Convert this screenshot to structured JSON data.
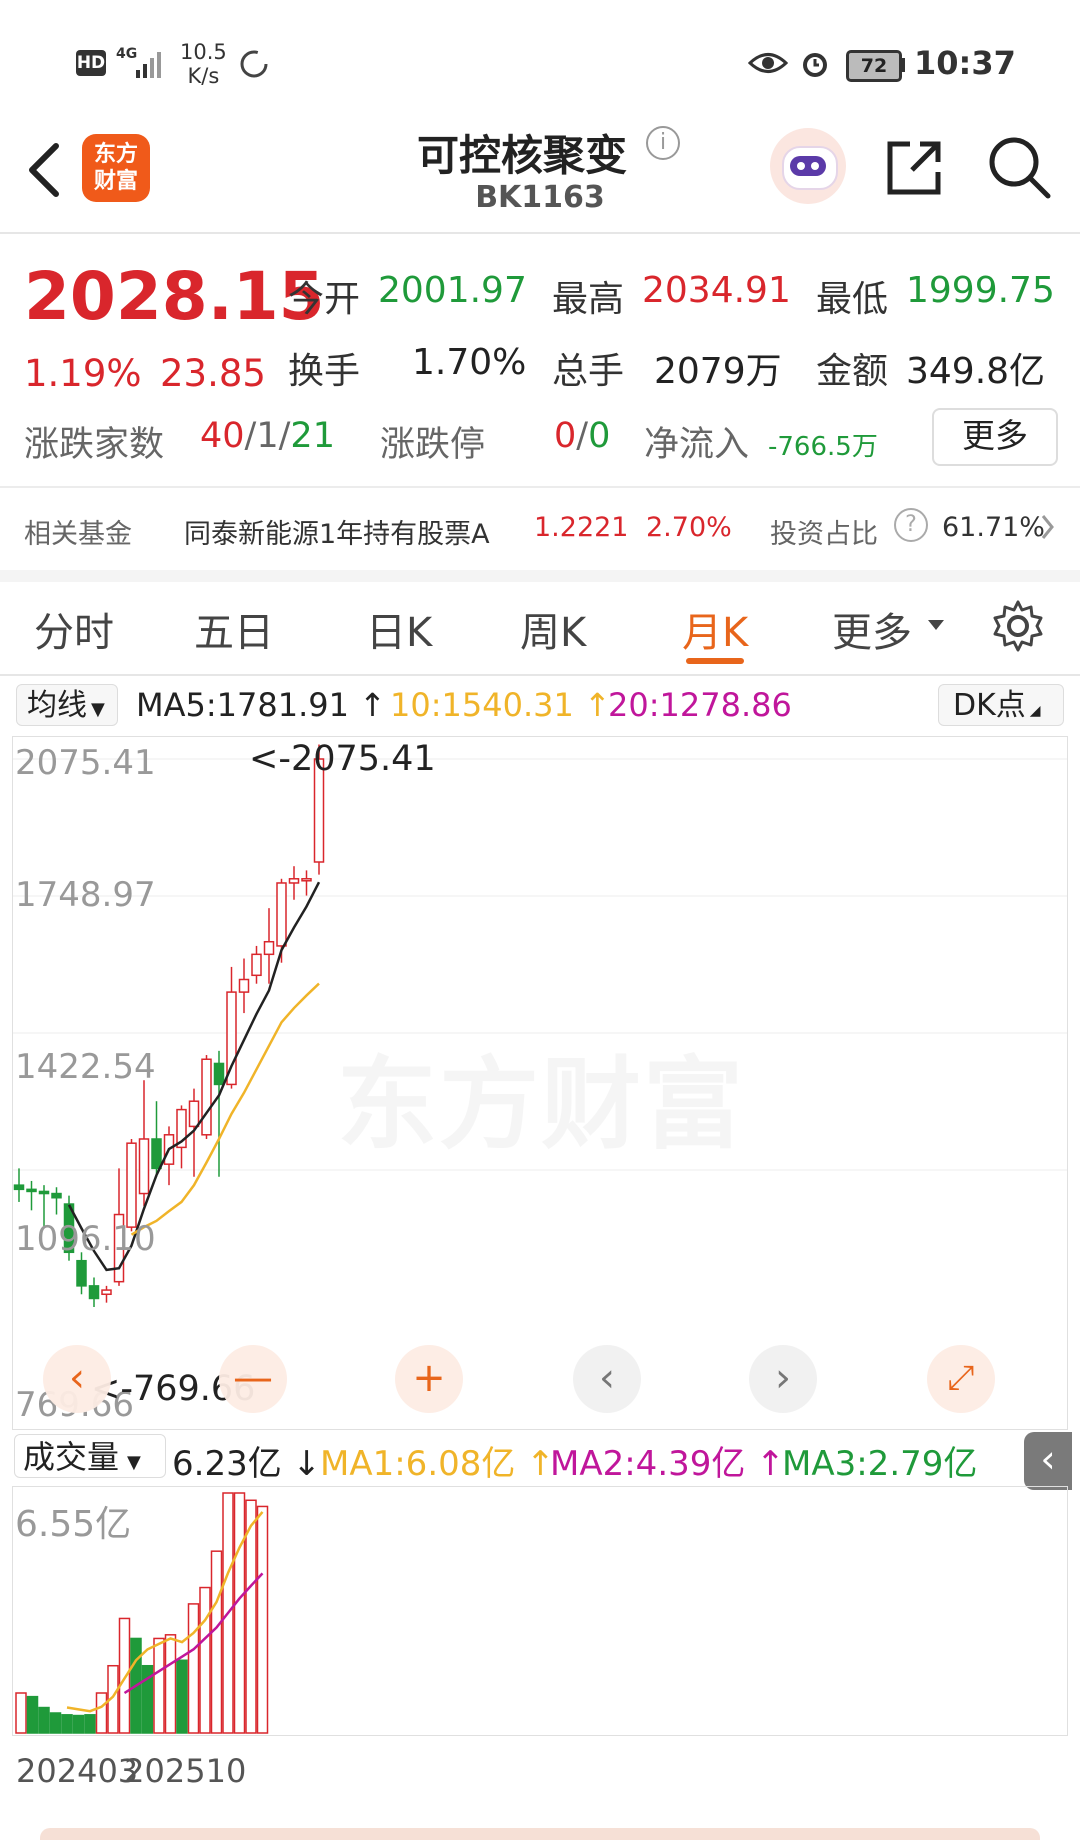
{
  "status_bar": {
    "hd": "HD",
    "signal": "4G",
    "speed_value": "10.5",
    "speed_unit": "K/s",
    "battery": "72",
    "time": "10:37"
  },
  "header": {
    "logo_line1": "东方",
    "logo_line2": "财富",
    "title": "可控核聚变",
    "code": "BK1163"
  },
  "quote": {
    "price": "2028.15",
    "change_pct": "1.19%",
    "change_abs": "23.85",
    "open_label": "今开",
    "open_value": "2001.97",
    "high_label": "最高",
    "high_value": "2034.91",
    "low_label": "最低",
    "low_value": "1999.75",
    "turnover_label": "换手",
    "turnover_value": "1.70%",
    "volume_label": "总手",
    "volume_value": "2079万",
    "amount_label": "金额",
    "amount_value": "349.8亿",
    "breadth_label": "涨跌家数",
    "breadth_up": "40",
    "breadth_flat": "1",
    "breadth_down": "21",
    "limit_label": "涨跌停",
    "limit_up": "0",
    "limit_down": "0",
    "inflow_label": "净流入",
    "inflow_value": "-766.5万",
    "more_button": "更多"
  },
  "fund": {
    "label": "相关基金",
    "name": "同泰新能源1年持有股票A",
    "nav": "1.2221",
    "change": "2.70%",
    "ratio_label": "投资占比",
    "ratio_value": "61.71%"
  },
  "tabs": [
    {
      "label": "分时"
    },
    {
      "label": "五日"
    },
    {
      "label": "日K"
    },
    {
      "label": "周K"
    },
    {
      "label": "月K"
    },
    {
      "label": "更多"
    }
  ],
  "ma_bar": {
    "selector": "均线",
    "ma5": "MA5:1781.91",
    "ma10": "10:1540.31",
    "ma20": "20:1278.86",
    "dk": "DK点"
  },
  "colors": {
    "up": "#d9262c",
    "down": "#1f9a3a",
    "ma5": "#222222",
    "ma10": "#f0b429",
    "ma20": "#c0169b",
    "accent": "#e8651b"
  },
  "volume_bar": {
    "selector": "成交量",
    "current": "6.23亿",
    "ma1": "MA1:6.08亿",
    "ma2": "MA2:4.39亿",
    "ma3": "MA3:2.79亿"
  },
  "chart_data": [
    {
      "type": "candlestick",
      "title": "",
      "y_ticks": [
        "2075.41",
        "1748.97",
        "1422.54",
        "1096.10",
        "769.66"
      ],
      "ylim": [
        769.66,
        2075.41
      ],
      "max_label": "<-2075.41",
      "min_label": "<-769.66",
      "watermark": "东方财富",
      "candles": [
        {
          "o": 1060,
          "h": 1100,
          "l": 1020,
          "c": 1050
        },
        {
          "o": 1050,
          "h": 1070,
          "l": 1000,
          "c": 1045
        },
        {
          "o": 1045,
          "h": 1060,
          "l": 960,
          "c": 1040
        },
        {
          "o": 1040,
          "h": 1055,
          "l": 990,
          "c": 1030
        },
        {
          "o": 1015,
          "h": 1035,
          "l": 880,
          "c": 900
        },
        {
          "o": 880,
          "h": 900,
          "l": 800,
          "c": 820
        },
        {
          "o": 820,
          "h": 840,
          "l": 769.66,
          "c": 790
        },
        {
          "o": 800,
          "h": 820,
          "l": 780,
          "c": 810
        },
        {
          "o": 830,
          "h": 1100,
          "l": 820,
          "c": 990
        },
        {
          "o": 960,
          "h": 1170,
          "l": 950,
          "c": 1160
        },
        {
          "o": 1040,
          "h": 1310,
          "l": 1010,
          "c": 1170
        },
        {
          "o": 1170,
          "h": 1260,
          "l": 1080,
          "c": 1100
        },
        {
          "o": 1110,
          "h": 1200,
          "l": 1060,
          "c": 1180
        },
        {
          "o": 1150,
          "h": 1250,
          "l": 1100,
          "c": 1240
        },
        {
          "o": 1200,
          "h": 1290,
          "l": 1080,
          "c": 1260
        },
        {
          "o": 1180,
          "h": 1370,
          "l": 1170,
          "c": 1360
        },
        {
          "o": 1350,
          "h": 1380,
          "l": 1080,
          "c": 1300
        },
        {
          "o": 1300,
          "h": 1580,
          "l": 1290,
          "c": 1520
        },
        {
          "o": 1520,
          "h": 1600,
          "l": 1470,
          "c": 1550
        },
        {
          "o": 1560,
          "h": 1630,
          "l": 1540,
          "c": 1610
        },
        {
          "o": 1610,
          "h": 1720,
          "l": 1540,
          "c": 1640
        },
        {
          "o": 1630,
          "h": 1790,
          "l": 1590,
          "c": 1780
        },
        {
          "o": 1780,
          "h": 1820,
          "l": 1740,
          "c": 1790
        },
        {
          "o": 1790,
          "h": 1810,
          "l": 1750,
          "c": 1790
        },
        {
          "o": 1830,
          "h": 2110,
          "l": 1800,
          "c": 2075.41
        }
      ],
      "ma5": [
        null,
        null,
        null,
        null,
        1013,
        957,
        903,
        858,
        862,
        916,
        1004,
        1084,
        1146,
        1164,
        1190,
        1232,
        1274,
        1344,
        1406,
        1468,
        1524,
        1620,
        1674,
        1724,
        1781.91
      ],
      "ma10": [
        null,
        null,
        null,
        null,
        null,
        null,
        null,
        null,
        null,
        942,
        960,
        975,
        998,
        1020,
        1060,
        1114,
        1170,
        1230,
        1280,
        1336,
        1392,
        1448,
        1482,
        1512,
        1540.31
      ],
      "volume": {
        "max_label": "6.55亿",
        "dates": [
          "202403",
          "202510"
        ],
        "bars": [
          {
            "v": 1.1,
            "up": true
          },
          {
            "v": 1.0,
            "up": false
          },
          {
            "v": 0.7,
            "up": false
          },
          {
            "v": 0.55,
            "up": false
          },
          {
            "v": 0.5,
            "up": false
          },
          {
            "v": 0.48,
            "up": false
          },
          {
            "v": 0.5,
            "up": false
          },
          {
            "v": 1.1,
            "up": true
          },
          {
            "v": 1.85,
            "up": true
          },
          {
            "v": 3.15,
            "up": true
          },
          {
            "v": 2.6,
            "up": false
          },
          {
            "v": 1.85,
            "up": false
          },
          {
            "v": 2.6,
            "up": true
          },
          {
            "v": 2.7,
            "up": true
          },
          {
            "v": 2.0,
            "up": false
          },
          {
            "v": 3.55,
            "up": true
          },
          {
            "v": 4.0,
            "up": true
          },
          {
            "v": 5.0,
            "up": true
          },
          {
            "v": 6.6,
            "up": true
          },
          {
            "v": 6.6,
            "up": true
          },
          {
            "v": 6.4,
            "up": true
          },
          {
            "v": 6.23,
            "up": true
          }
        ],
        "ma1": [
          null,
          null,
          null,
          null,
          0.7,
          0.65,
          0.6,
          0.72,
          1.0,
          1.5,
          2.0,
          2.3,
          2.45,
          2.6,
          2.5,
          2.75,
          3.1,
          3.6,
          4.4,
          5.1,
          5.7,
          6.08
        ],
        "ma2": [
          null,
          null,
          null,
          null,
          null,
          null,
          null,
          null,
          null,
          1.1,
          1.3,
          1.5,
          1.7,
          1.9,
          2.1,
          2.3,
          2.6,
          2.9,
          3.3,
          3.7,
          4.05,
          4.39
        ]
      }
    }
  ]
}
